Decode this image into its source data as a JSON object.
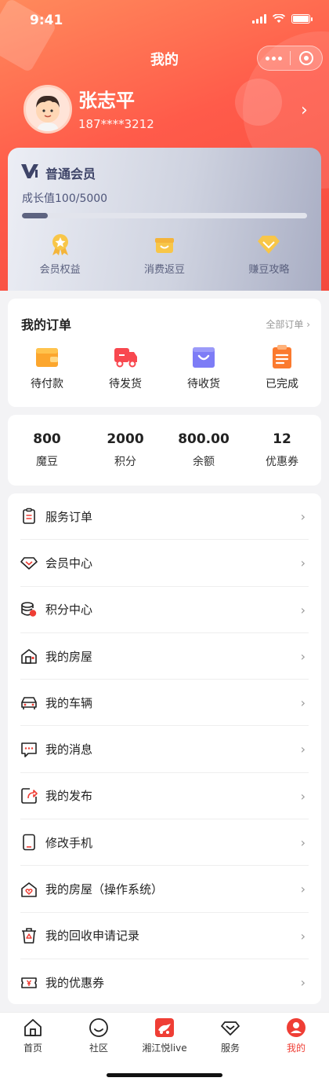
{
  "status_bar": {
    "time": "9:41"
  },
  "page": {
    "title": "我的"
  },
  "profile": {
    "name": "张志平",
    "phone": "187****3212"
  },
  "membership": {
    "level": "普通会员",
    "growth_text": "成长值100/5000",
    "growth_progress": 0.02,
    "perks": [
      {
        "label": "会员权益",
        "icon": "medal-icon"
      },
      {
        "label": "消费返豆",
        "icon": "gift-box-icon"
      },
      {
        "label": "赚豆攻略",
        "icon": "diamond-icon"
      }
    ]
  },
  "orders": {
    "title": "我的订单",
    "all_label": "全部订单",
    "items": [
      {
        "label": "待付款",
        "icon": "wallet-icon"
      },
      {
        "label": "待发货",
        "icon": "delivery-truck-icon"
      },
      {
        "label": "待收货",
        "icon": "shopping-bag-icon"
      },
      {
        "label": "已完成",
        "icon": "clipboard-icon"
      }
    ]
  },
  "assets": [
    {
      "value": "800",
      "label": "魔豆"
    },
    {
      "value": "2000",
      "label": "积分"
    },
    {
      "value": "800.00",
      "label": "余额"
    },
    {
      "value": "12",
      "label": "优惠券"
    }
  ],
  "menu": [
    {
      "label": "服务订单",
      "icon": "service-order-icon"
    },
    {
      "label": "会员中心",
      "icon": "member-diamond-icon"
    },
    {
      "label": "积分中心",
      "icon": "points-coins-icon"
    },
    {
      "label": "我的房屋",
      "icon": "house-icon"
    },
    {
      "label": "我的车辆",
      "icon": "car-icon"
    },
    {
      "label": "我的消息",
      "icon": "message-icon"
    },
    {
      "label": "我的发布",
      "icon": "publish-icon"
    },
    {
      "label": "修改手机",
      "icon": "phone-icon"
    },
    {
      "label": "我的房屋（操作系统）",
      "icon": "house-heart-icon"
    },
    {
      "label": "我的回收申请记录",
      "icon": "recycle-bin-icon"
    },
    {
      "label": "我的优惠券",
      "icon": "coupon-icon"
    }
  ],
  "tabbar": [
    {
      "label": "首页",
      "icon": "home-icon",
      "active": false
    },
    {
      "label": "社区",
      "icon": "smile-icon",
      "active": false
    },
    {
      "label": "湘江悦live",
      "icon": "live-icon",
      "active": false
    },
    {
      "label": "服务",
      "icon": "service-icon",
      "active": false
    },
    {
      "label": "我的",
      "icon": "profile-icon",
      "active": true
    }
  ],
  "colors": {
    "accent": "#ef3e35",
    "header_start": "#ff8a5c",
    "header_end": "#f44a3d",
    "vip_text": "#3e4468"
  }
}
